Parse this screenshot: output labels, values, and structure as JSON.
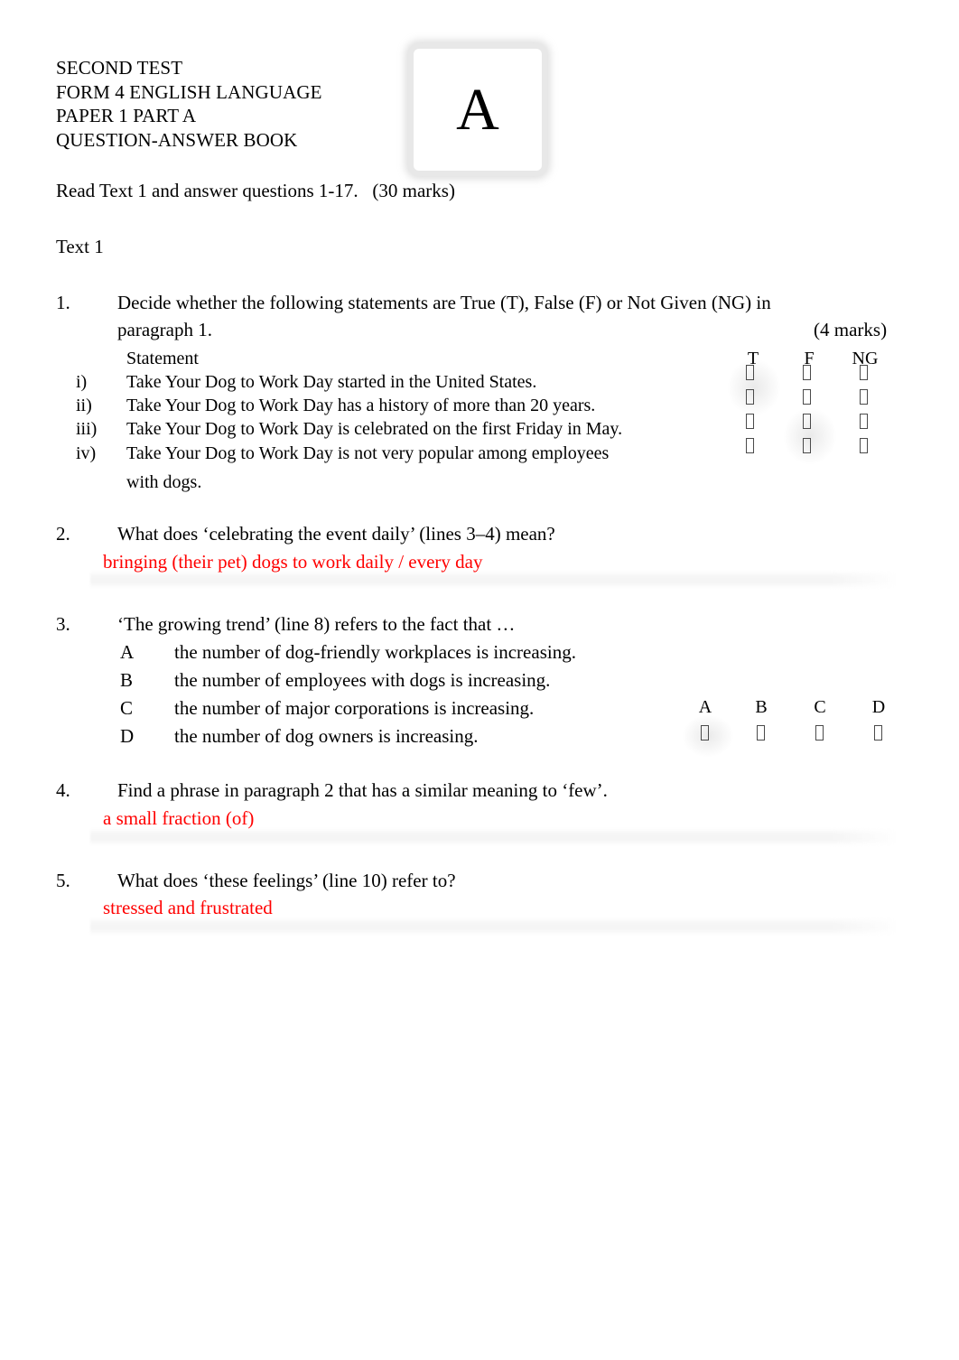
{
  "header": {
    "lines": [
      "SECOND TEST",
      "FORM 4 ENGLISH LANGUAGE",
      "PAPER 1 PART A",
      "QUESTION-ANSWER BOOK"
    ],
    "paper_badge_letter": "A"
  },
  "instruction": "Read Text 1 and answer questions 1-17.   (30 marks)",
  "text_label": "Text 1",
  "questions": [
    {
      "number": "1.",
      "prompt_line1": "Decide whether the following statements are True (T), False (F) or Not Given (NG) in",
      "prompt_line2": "paragraph 1.",
      "marks": "(4 marks)",
      "table": {
        "statement_header": "Statement",
        "column_headers": [
          "T",
          "F",
          "NG"
        ],
        "rows": [
          {
            "label": "i)",
            "text": "Take Your Dog to Work Day started in the United States."
          },
          {
            "label": "ii)",
            "text": "Take Your Dog to Work Day has a history of more than 20 years."
          },
          {
            "label": "iii)",
            "text": "Take Your Dog to Work Day is celebrated on the first Friday in May."
          },
          {
            "label": "iv)",
            "text": "Take Your Dog to Work Day is not very popular among employees"
          },
          {
            "label": "",
            "text": "with dogs."
          }
        ]
      }
    },
    {
      "number": "2.",
      "prompt": "What does ‘celebrating the event daily’ (lines 3–4) mean?",
      "answer": "bringing (their pet) dogs to work daily / every day"
    },
    {
      "number": "3.",
      "prompt": "‘The growing trend’ (line 8) refers to the fact that …",
      "options": [
        {
          "letter": "A",
          "text": "the number of dog-friendly workplaces is increasing."
        },
        {
          "letter": "B",
          "text": "the number of employees with dogs is increasing."
        },
        {
          "letter": "C",
          "text": "the number of major corporations is increasing."
        },
        {
          "letter": "D",
          "text": "the number of dog owners is increasing."
        }
      ],
      "column_headers": [
        "A",
        "B",
        "C",
        "D"
      ]
    },
    {
      "number": "4.",
      "prompt": "Find a phrase in paragraph 2 that has a similar meaning to ‘few’.",
      "answer": "a small fraction (of)"
    },
    {
      "number": "5.",
      "prompt": "What does ‘these feelings’ (line 10) refer to?",
      "answer": "stressed and frustrated"
    }
  ],
  "colors": {
    "answer_red": "#FF0000",
    "body_text": "#000000",
    "answer_line_gray": "#f0f0f0"
  }
}
